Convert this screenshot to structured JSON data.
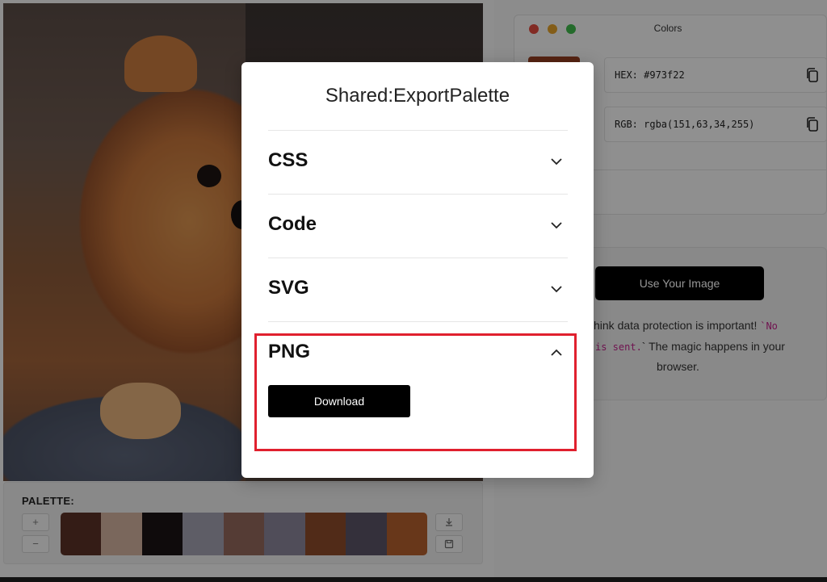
{
  "background": {
    "palette": {
      "label": "PALETTE:",
      "add_label": "+",
      "remove_label": "−",
      "swatches": [
        "#5a3126",
        "#d3b19f",
        "#1a1416",
        "#a3a1b0",
        "#93685c",
        "#8a8699",
        "#8c4a2a",
        "#5a5366",
        "#b35f2e"
      ]
    },
    "colors_window": {
      "title": "Colors",
      "selected_color": "#973f22",
      "hex_value": "HEX: #973f22",
      "rgb_value": "RGB: rgba(151,63,34,255)"
    },
    "upload": {
      "button_label": "Use Your Image",
      "privacy_text_1": "hink data protection is important! ",
      "privacy_code_1": "`No",
      "privacy_code_2": "is sent.",
      "privacy_text_2": "` The magic happens in your",
      "privacy_text_3": "browser."
    }
  },
  "modal": {
    "title": "Shared:ExportPalette",
    "sections": [
      {
        "label": "CSS",
        "expanded": false
      },
      {
        "label": "Code",
        "expanded": false
      },
      {
        "label": "SVG",
        "expanded": false
      },
      {
        "label": "PNG",
        "expanded": true
      }
    ],
    "download_label": "Download"
  },
  "colors": {
    "highlight": "#e0202e",
    "accent": "#000000"
  }
}
